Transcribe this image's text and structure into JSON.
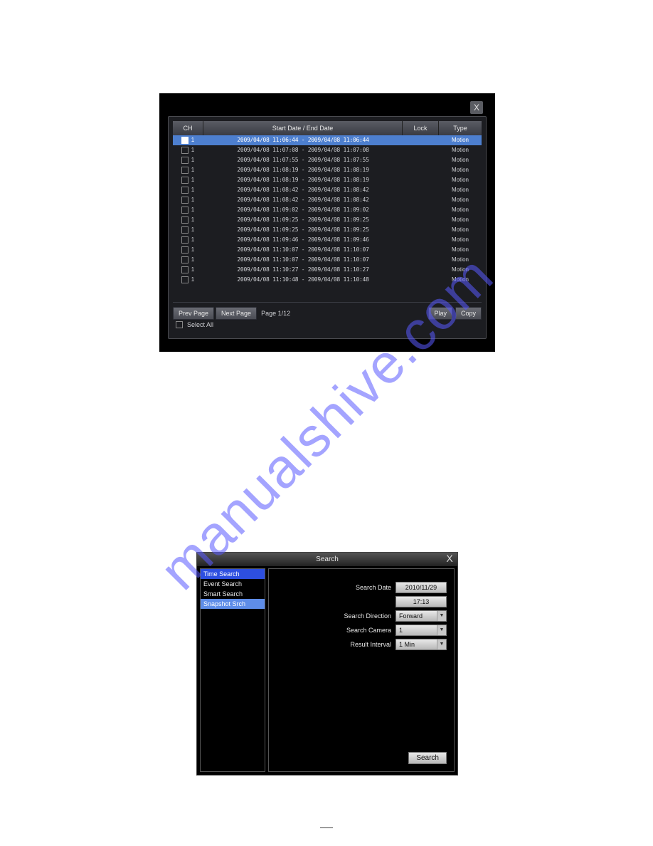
{
  "watermark": "manualshive.com",
  "panel1": {
    "headers": {
      "ch": "CH",
      "date": "Start Date / End Date",
      "lock": "Lock",
      "type": "Type"
    },
    "rows": [
      {
        "ch": "1",
        "date": "2009/04/08 11:06:44 - 2009/04/08 11:06:44",
        "lock": "",
        "type": "Motion",
        "selected": true
      },
      {
        "ch": "1",
        "date": "2009/04/08 11:07:08 - 2009/04/08 11:07:08",
        "lock": "",
        "type": "Motion",
        "selected": false
      },
      {
        "ch": "1",
        "date": "2009/04/08 11:07:55 - 2009/04/08 11:07:55",
        "lock": "",
        "type": "Motion",
        "selected": false
      },
      {
        "ch": "1",
        "date": "2009/04/08 11:08:19 - 2009/04/08 11:08:19",
        "lock": "",
        "type": "Motion",
        "selected": false
      },
      {
        "ch": "1",
        "date": "2009/04/08 11:08:19 - 2009/04/08 11:08:19",
        "lock": "",
        "type": "Motion",
        "selected": false
      },
      {
        "ch": "1",
        "date": "2009/04/08 11:08:42 - 2009/04/08 11:08:42",
        "lock": "",
        "type": "Motion",
        "selected": false
      },
      {
        "ch": "1",
        "date": "2009/04/08 11:08:42 - 2009/04/08 11:08:42",
        "lock": "",
        "type": "Motion",
        "selected": false
      },
      {
        "ch": "1",
        "date": "2009/04/08 11:09:02 - 2009/04/08 11:09:02",
        "lock": "",
        "type": "Motion",
        "selected": false
      },
      {
        "ch": "1",
        "date": "2009/04/08 11:09:25 - 2009/04/08 11:09:25",
        "lock": "",
        "type": "Motion",
        "selected": false
      },
      {
        "ch": "1",
        "date": "2009/04/08 11:09:25 - 2009/04/08 11:09:25",
        "lock": "",
        "type": "Motion",
        "selected": false
      },
      {
        "ch": "1",
        "date": "2009/04/08 11:09:46 - 2009/04/08 11:09:46",
        "lock": "",
        "type": "Motion",
        "selected": false
      },
      {
        "ch": "1",
        "date": "2009/04/08 11:10:07 - 2009/04/08 11:10:07",
        "lock": "",
        "type": "Motion",
        "selected": false
      },
      {
        "ch": "1",
        "date": "2009/04/08 11:10:07 - 2009/04/08 11:10:07",
        "lock": "",
        "type": "Motion",
        "selected": false
      },
      {
        "ch": "1",
        "date": "2009/04/08 11:10:27 - 2009/04/08 11:10:27",
        "lock": "",
        "type": "Motion",
        "selected": false
      },
      {
        "ch": "1",
        "date": "2009/04/08 11:10:48 - 2009/04/08 11:10:48",
        "lock": "",
        "type": "Motion",
        "selected": false
      }
    ],
    "prev": "Prev Page",
    "next": "Next Page",
    "pageLabel": "Page 1/12",
    "play": "Play",
    "copy": "Copy",
    "selectAll": "Select All",
    "close": "X"
  },
  "panel2": {
    "title": "Search",
    "close": "X",
    "side": [
      {
        "label": "Time Search",
        "class": "hl1"
      },
      {
        "label": "Event Search",
        "class": ""
      },
      {
        "label": "Smart Search",
        "class": ""
      },
      {
        "label": "Snapshot Srch",
        "class": "hl2"
      }
    ],
    "form": {
      "searchDateLabel": "Search Date",
      "searchDateValue": "2010/11/29",
      "searchTimeValue": "17:13",
      "searchDirectionLabel": "Search Direction",
      "searchDirectionValue": "Forward",
      "searchCameraLabel": "Search Camera",
      "searchCameraValue": "1",
      "resultIntervalLabel": "Result Interval",
      "resultIntervalValue": "1 Min"
    },
    "searchBtn": "Search"
  }
}
